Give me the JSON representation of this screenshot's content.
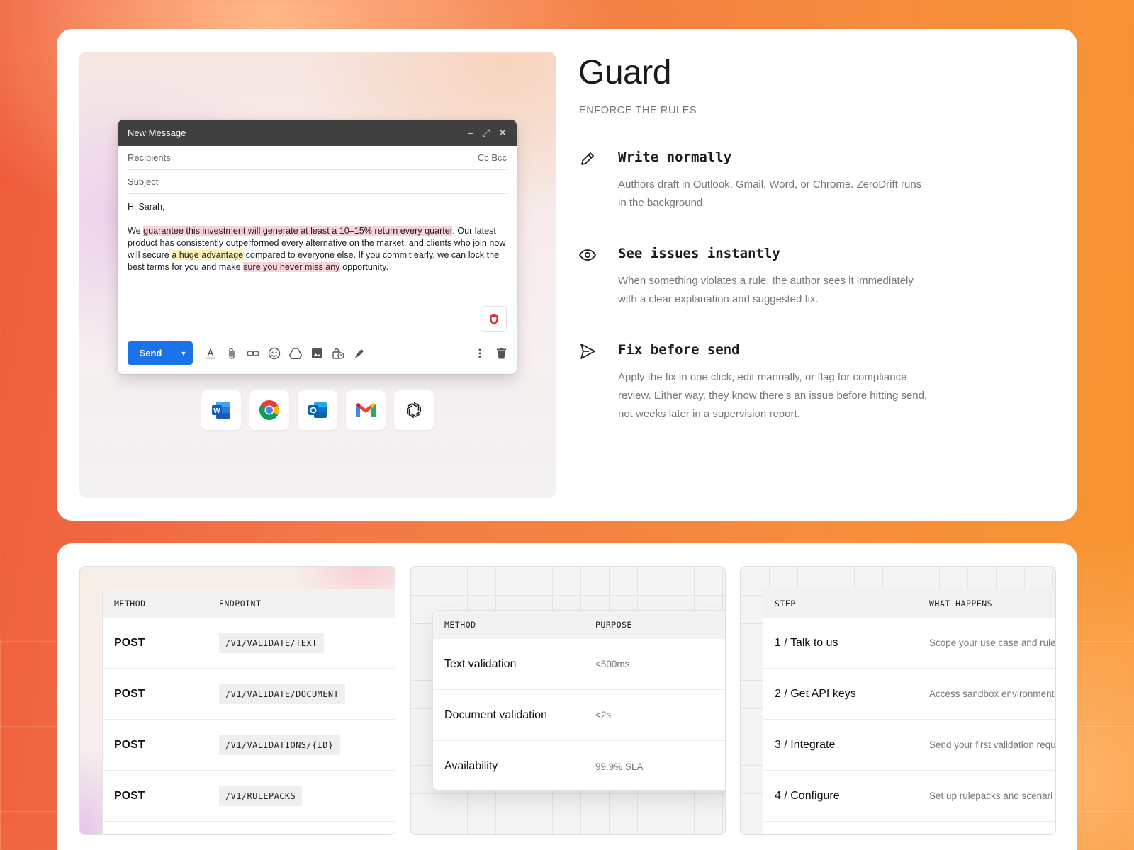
{
  "guard": {
    "title": "Guard",
    "subtitle": "ENFORCE THE RULES",
    "features": [
      {
        "icon": "pencil-icon",
        "title": "Write normally",
        "text": "Authors draft in Outlook, Gmail, Word, or Chrome. ZeroDrift runs in the background."
      },
      {
        "icon": "eye-icon",
        "title": "See issues instantly",
        "text": "When something violates a rule, the author sees it immediately with a clear explanation and suggested fix."
      },
      {
        "icon": "send-icon",
        "title": "Fix before send",
        "text": "Apply the fix in one click, edit manually, or flag for compliance review. Either way, they know there's an issue before hitting send, not weeks later in a supervision report."
      }
    ]
  },
  "email": {
    "window_title": "New Message",
    "recipients_placeholder": "Recipients",
    "cc_bcc": "Cc Bcc",
    "subject_placeholder": "Subject",
    "greeting": "Hi Sarah,",
    "body": {
      "s1": "We ",
      "h1": "guarantee this investment will generate at least a 10–15% return every quarter",
      "s2": ". Our latest product has consistently outperformed every alternative on the market, and clients who join now will secure ",
      "h2": "a huge advantage",
      "s3": " compared to everyone else. If you commit early, we can lock the best terms for you and make ",
      "h3": "sure you never miss any",
      "s4": " opportunity."
    },
    "send_label": "Send"
  },
  "apps": [
    "word-icon",
    "chrome-icon",
    "outlook-icon",
    "gmail-icon",
    "openai-icon"
  ],
  "api_table": {
    "headers": [
      "METHOD",
      "ENDPOINT"
    ],
    "rows": [
      {
        "method": "POST",
        "endpoint": "/V1/VALIDATE/TEXT"
      },
      {
        "method": "POST",
        "endpoint": "/V1/VALIDATE/DOCUMENT"
      },
      {
        "method": "POST",
        "endpoint": "/V1/VALIDATIONS/{ID}"
      },
      {
        "method": "POST",
        "endpoint": "/V1/RULEPACKS"
      }
    ]
  },
  "perf_table": {
    "headers": [
      "METHOD",
      "PURPOSE"
    ],
    "rows": [
      {
        "method": "Text validation",
        "purpose": "<500ms"
      },
      {
        "method": "Document validation",
        "purpose": "<2s"
      },
      {
        "method": "Availability",
        "purpose": "99.9% SLA"
      }
    ]
  },
  "steps_table": {
    "headers": [
      "STEP",
      "WHAT HAPPENS"
    ],
    "rows": [
      {
        "step": "1 / Talk to us",
        "what": "Scope your use case and rule"
      },
      {
        "step": "2 / Get API keys",
        "what": "Access sandbox environment"
      },
      {
        "step": "3 / Integrate",
        "what": "Send your first validation requ"
      },
      {
        "step": "4 / Configure",
        "what": "Set up rulepacks and scenari"
      }
    ]
  }
}
